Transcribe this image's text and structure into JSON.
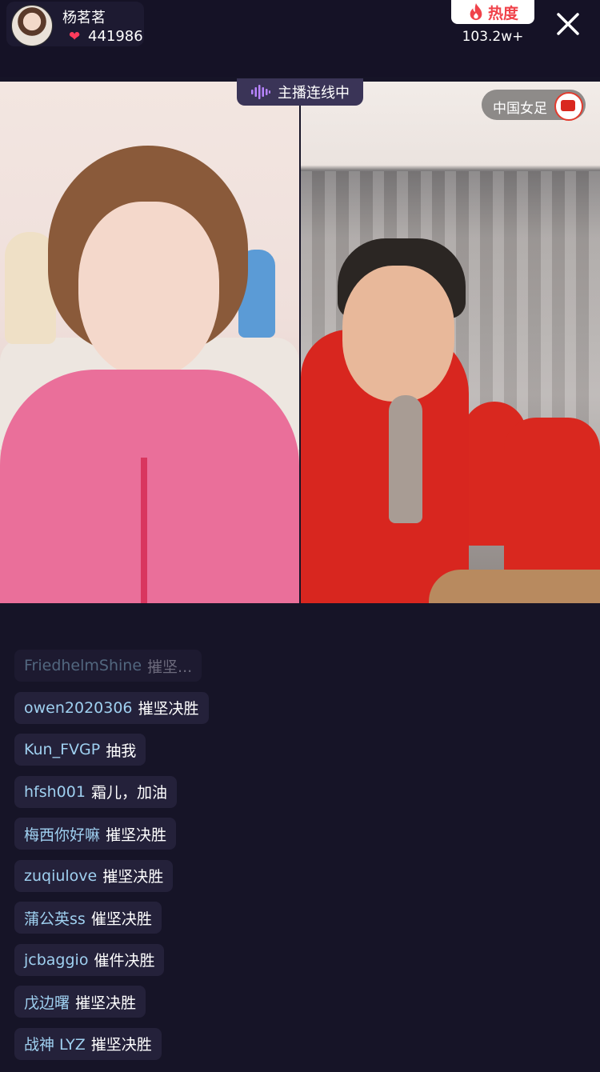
{
  "host": {
    "name": "杨茗茗",
    "likes": "441986"
  },
  "hot": {
    "label": "热度",
    "value": "103.2w+"
  },
  "link_badge": "主播连线中",
  "partner": {
    "name": "中国女足"
  },
  "comments": [
    {
      "user": "FriedhelmShine",
      "text": "摧坚..."
    },
    {
      "user": "owen2020306",
      "text": "摧坚决胜"
    },
    {
      "user": "Kun_FVGP",
      "text": "抽我"
    },
    {
      "user": "hfsh001",
      "text": "霜儿，加油"
    },
    {
      "user": "梅西你好嘛",
      "text": "摧坚决胜"
    },
    {
      "user": "zuqiulove",
      "text": "摧坚决胜"
    },
    {
      "user": "蒲公英ss",
      "text": "催坚决胜"
    },
    {
      "user": "jcbaggio",
      "text": "催件决胜"
    },
    {
      "user": "戊边曙",
      "text": "摧坚决胜"
    },
    {
      "user": "战神 LYZ",
      "text": "摧坚决胜"
    }
  ],
  "colors": {
    "background": "#161427",
    "username": "#9fd0f0",
    "hot_accent": "#f0424a",
    "heart": "#ff3b5c"
  },
  "icons": {
    "heart": "heart-icon",
    "flame": "flame-icon",
    "close": "close-icon",
    "wave": "audio-wave-icon",
    "team_logo": "team-logo-icon"
  }
}
